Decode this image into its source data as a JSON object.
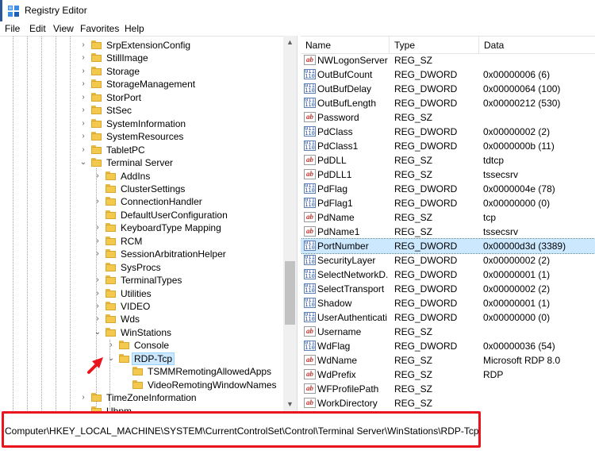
{
  "window": {
    "title": "Registry Editor",
    "icon": "registry-editor-icon"
  },
  "menu": [
    "File",
    "Edit",
    "View",
    "Favorites",
    "Help"
  ],
  "tree": {
    "rows": [
      {
        "label": "SrpExtensionConfig",
        "expander": "›"
      },
      {
        "label": "StillImage",
        "expander": "›"
      },
      {
        "label": "Storage",
        "expander": "›"
      },
      {
        "label": "StorageManagement",
        "expander": "›"
      },
      {
        "label": "StorPort",
        "expander": "›"
      },
      {
        "label": "StSec",
        "expander": "›"
      },
      {
        "label": "SystemInformation",
        "expander": "›"
      },
      {
        "label": "SystemResources",
        "expander": "›"
      },
      {
        "label": "TabletPC",
        "expander": "›"
      },
      {
        "label": "Terminal Server",
        "expander": "⌄"
      },
      {
        "label": "AddIns",
        "expander": "›"
      },
      {
        "label": "ClusterSettings",
        "expander": ""
      },
      {
        "label": "ConnectionHandler",
        "expander": "›"
      },
      {
        "label": "DefaultUserConfiguration",
        "expander": ""
      },
      {
        "label": "KeyboardType Mapping",
        "expander": "›"
      },
      {
        "label": "RCM",
        "expander": "›"
      },
      {
        "label": "SessionArbitrationHelper",
        "expander": "›"
      },
      {
        "label": "SysProcs",
        "expander": ""
      },
      {
        "label": "TerminalTypes",
        "expander": "›"
      },
      {
        "label": "Utilities",
        "expander": "›"
      },
      {
        "label": "VIDEO",
        "expander": "›"
      },
      {
        "label": "Wds",
        "expander": "›"
      },
      {
        "label": "WinStations",
        "expander": "⌄"
      },
      {
        "label": "Console",
        "expander": "›"
      },
      {
        "label": "RDP-Tcp",
        "expander": "⌄"
      },
      {
        "label": "TSMMRemotingAllowedApps",
        "expander": ""
      },
      {
        "label": "VideoRemotingWindowNames",
        "expander": ""
      },
      {
        "label": "TimeZoneInformation",
        "expander": "›"
      },
      {
        "label": "Ubpm",
        "expander": ""
      }
    ]
  },
  "values": {
    "columns": {
      "name": "Name",
      "type": "Type",
      "data": "Data"
    },
    "rows": [
      {
        "name": "NWLogonServer",
        "type": "REG_SZ",
        "data": "",
        "kind": "sz"
      },
      {
        "name": "OutBufCount",
        "type": "REG_DWORD",
        "data": "0x00000006 (6)",
        "kind": "dword"
      },
      {
        "name": "OutBufDelay",
        "type": "REG_DWORD",
        "data": "0x00000064 (100)",
        "kind": "dword"
      },
      {
        "name": "OutBufLength",
        "type": "REG_DWORD",
        "data": "0x00000212 (530)",
        "kind": "dword"
      },
      {
        "name": "Password",
        "type": "REG_SZ",
        "data": "",
        "kind": "sz"
      },
      {
        "name": "PdClass",
        "type": "REG_DWORD",
        "data": "0x00000002 (2)",
        "kind": "dword"
      },
      {
        "name": "PdClass1",
        "type": "REG_DWORD",
        "data": "0x0000000b (11)",
        "kind": "dword"
      },
      {
        "name": "PdDLL",
        "type": "REG_SZ",
        "data": "tdtcp",
        "kind": "sz"
      },
      {
        "name": "PdDLL1",
        "type": "REG_SZ",
        "data": "tssecsrv",
        "kind": "sz"
      },
      {
        "name": "PdFlag",
        "type": "REG_DWORD",
        "data": "0x0000004e (78)",
        "kind": "dword"
      },
      {
        "name": "PdFlag1",
        "type": "REG_DWORD",
        "data": "0x00000000 (0)",
        "kind": "dword"
      },
      {
        "name": "PdName",
        "type": "REG_SZ",
        "data": "tcp",
        "kind": "sz"
      },
      {
        "name": "PdName1",
        "type": "REG_SZ",
        "data": "tssecsrv",
        "kind": "sz"
      },
      {
        "name": "PortNumber",
        "type": "REG_DWORD",
        "data": "0x00000d3d (3389)",
        "kind": "dword"
      },
      {
        "name": "SecurityLayer",
        "type": "REG_DWORD",
        "data": "0x00000002 (2)",
        "kind": "dword"
      },
      {
        "name": "SelectNetworkD...",
        "type": "REG_DWORD",
        "data": "0x00000001 (1)",
        "kind": "dword"
      },
      {
        "name": "SelectTransport",
        "type": "REG_DWORD",
        "data": "0x00000002 (2)",
        "kind": "dword"
      },
      {
        "name": "Shadow",
        "type": "REG_DWORD",
        "data": "0x00000001 (1)",
        "kind": "dword"
      },
      {
        "name": "UserAuthenticati...",
        "type": "REG_DWORD",
        "data": "0x00000000 (0)",
        "kind": "dword"
      },
      {
        "name": "Username",
        "type": "REG_SZ",
        "data": "",
        "kind": "sz"
      },
      {
        "name": "WdFlag",
        "type": "REG_DWORD",
        "data": "0x00000036 (54)",
        "kind": "dword"
      },
      {
        "name": "WdName",
        "type": "REG_SZ",
        "data": "Microsoft RDP 8.0",
        "kind": "sz"
      },
      {
        "name": "WdPrefix",
        "type": "REG_SZ",
        "data": "RDP",
        "kind": "sz"
      },
      {
        "name": "WFProfilePath",
        "type": "REG_SZ",
        "data": "",
        "kind": "sz"
      },
      {
        "name": "WorkDirectory",
        "type": "REG_SZ",
        "data": "",
        "kind": "sz"
      }
    ],
    "sz_icon_text": "ab",
    "dword_icon_text": "011 110"
  },
  "status": {
    "path": "Computer\\HKEY_LOCAL_MACHINE\\SYSTEM\\CurrentControlSet\\Control\\Terminal Server\\WinStations\\RDP-Tcp"
  },
  "colors": {
    "selection": "#cce8ff",
    "highlight_box": "#e8141e",
    "folder": "#f2c94c"
  }
}
